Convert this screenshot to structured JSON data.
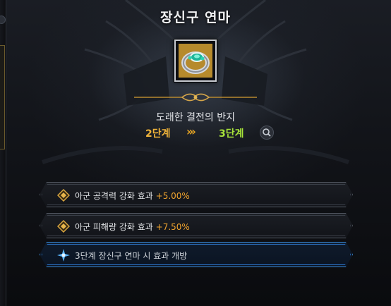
{
  "header": {
    "title": "장신구 연마"
  },
  "item": {
    "name": "도래한 결전의 반지",
    "icon": "ring-icon"
  },
  "upgrade": {
    "from_stage": "2단계",
    "arrows": "›››",
    "to_stage": "3단계",
    "search_icon": "search-icon"
  },
  "effects": [
    {
      "label": "아군 공격력 강화 효과",
      "value": "+5.00%",
      "icon": "gold-diamond-icon"
    },
    {
      "label": "아군 피해량 강화 효과",
      "value": "+7.50%",
      "icon": "gold-diamond-icon"
    },
    {
      "label": "3단계 장신구 연마 시 효과 개방",
      "value": "",
      "icon": "blue-star-icon",
      "highlighted": true
    }
  ],
  "colors": {
    "stage_from": "#f0b43a",
    "stage_to": "#a6e23a",
    "effect_value": "#f2a52e",
    "active_glow": "#3a8fe0"
  }
}
